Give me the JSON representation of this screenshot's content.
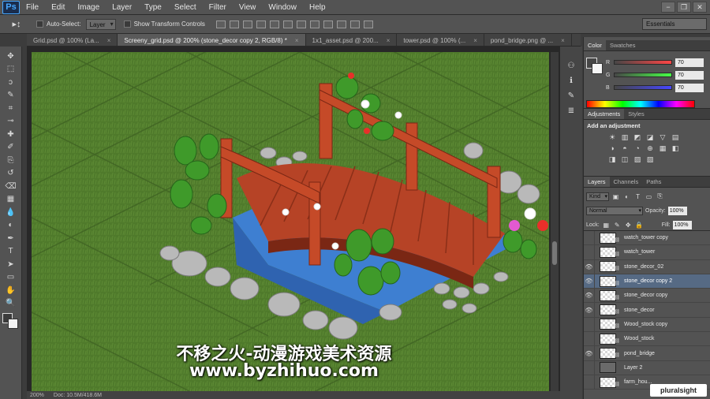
{
  "app": {
    "logo": "Ps",
    "window_controls": [
      "−",
      "❐",
      "✕"
    ]
  },
  "menu": [
    "File",
    "Edit",
    "Image",
    "Layer",
    "Type",
    "Select",
    "Filter",
    "View",
    "Window",
    "Help"
  ],
  "options_bar": {
    "auto_select_label": "Auto-Select:",
    "auto_select_target": "Layer",
    "transform_label": "Show Transform Controls",
    "workspace": "Essentials"
  },
  "tabs": [
    {
      "label": "Grid.psd @ 100% (La...",
      "active": false
    },
    {
      "label": "Screeny_grid.psd @ 200% (stone_decor copy 2, RGB/8) *",
      "active": true
    },
    {
      "label": "1x1_asset.psd @ 200...",
      "active": false
    },
    {
      "label": "tower.psd @ 100% (...",
      "active": false
    },
    {
      "label": "pond_bridge.png @ ...",
      "active": false
    }
  ],
  "tools": [
    "move-icon",
    "marquee-icon",
    "lasso-icon",
    "quick-select-icon",
    "crop-icon",
    "eyedropper-icon",
    "healing-icon",
    "brush-icon",
    "clone-stamp-icon",
    "history-brush-icon",
    "eraser-icon",
    "gradient-icon",
    "blur-icon",
    "dodge-icon",
    "pen-icon",
    "type-icon",
    "path-select-icon",
    "shape-icon",
    "hand-icon",
    "zoom-icon"
  ],
  "tool_glyphs": [
    "✥",
    "⬚",
    "ↄ",
    "✎",
    "⌗",
    "⊸",
    "✚",
    "✐",
    "⎘",
    "↺",
    "⌫",
    "▦",
    "💧",
    "◐",
    "✒",
    "T",
    "➤",
    "▭",
    "✋",
    "🔍"
  ],
  "canvas": {
    "watermark_line1": "不移之火-动漫游戏美术资源",
    "watermark_line2": "www.byzhihuo.com",
    "status_zoom": "200%",
    "status_doc": "Doc: 10.5M/418.6M"
  },
  "color_panel": {
    "tabs": [
      "Color",
      "Swatches"
    ],
    "channels": [
      {
        "label": "R",
        "value": "70",
        "gradient": "#ff0000"
      },
      {
        "label": "G",
        "value": "70",
        "gradient": "#00ff00"
      },
      {
        "label": "B",
        "value": "70",
        "gradient": "#0000ff"
      }
    ]
  },
  "adjustments_panel": {
    "tabs": [
      "Adjustments",
      "Styles"
    ],
    "title": "Add an adjustment",
    "icons": [
      "☀",
      "▥",
      "◩",
      "◪",
      "▽",
      "",
      "▤",
      "◑",
      "◓",
      "◔",
      "⊕",
      "▦",
      "◧",
      "◨",
      "◫",
      "▨",
      "▧",
      ""
    ]
  },
  "layers_panel": {
    "tabs": [
      "Layers",
      "Channels",
      "Paths"
    ],
    "kind": "Kind",
    "blend_mode": "Normal",
    "opacity_label": "Opacity:",
    "opacity": "100%",
    "lock_label": "Lock:",
    "fill_label": "Fill:",
    "fill": "100%",
    "layers": [
      {
        "name": "watch_tower copy",
        "visible": false,
        "selected": false,
        "solid": false
      },
      {
        "name": "watch_tower",
        "visible": false,
        "selected": false,
        "solid": false
      },
      {
        "name": "stone_decor_02",
        "visible": true,
        "selected": false,
        "solid": false
      },
      {
        "name": "stone_decor copy 2",
        "visible": true,
        "selected": true,
        "solid": false
      },
      {
        "name": "stone_decor copy",
        "visible": true,
        "selected": false,
        "solid": false
      },
      {
        "name": "stone_decor",
        "visible": true,
        "selected": false,
        "solid": false
      },
      {
        "name": "Wood_stock copy",
        "visible": false,
        "selected": false,
        "solid": false
      },
      {
        "name": "Wood_stock",
        "visible": false,
        "selected": false,
        "solid": false
      },
      {
        "name": "pond_bridge",
        "visible": true,
        "selected": false,
        "solid": false
      },
      {
        "name": "Layer 2",
        "visible": false,
        "selected": false,
        "solid": true
      },
      {
        "name": "farm_hou...",
        "visible": false,
        "selected": false,
        "solid": false
      }
    ]
  },
  "branding": "pluralsight"
}
